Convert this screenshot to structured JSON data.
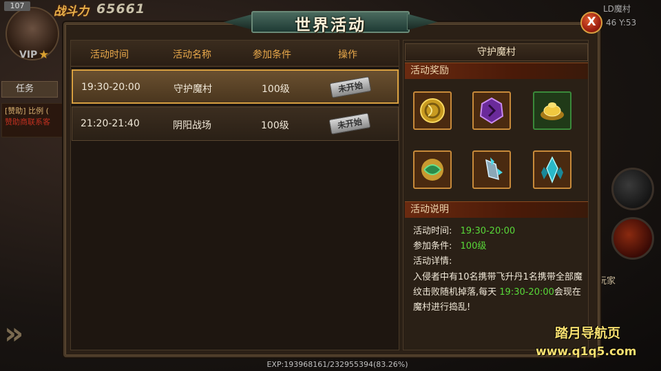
{
  "hud": {
    "level_badge": "107",
    "power_label": "战斗力",
    "power_value": "65661",
    "vip_label": "VIP",
    "task_tab": "任务",
    "chat_line1": "[赞助] 比例 (",
    "chat_line2": "赞助商联系客",
    "map_name": "LD魔村",
    "map_coords": "46 Y:53",
    "player_label": "玩家",
    "exp_text": "EXP:193968161/232955394(83.26%)"
  },
  "window": {
    "title": "世界活动",
    "close_label": "X"
  },
  "table": {
    "columns": [
      "活动时间",
      "活动名称",
      "参加条件",
      "操作"
    ],
    "rows": [
      {
        "time": "19:30-20:00",
        "name": "守护魔村",
        "condition": "100级",
        "status": "未开始"
      },
      {
        "time": "21:20-21:40",
        "name": "阴阳战场",
        "condition": "100级",
        "status": "未开始"
      }
    ]
  },
  "detail": {
    "header": "守护魔村",
    "rewards_label": "活动奖励",
    "rewards": [
      {
        "icon": "gold-coin-icon"
      },
      {
        "icon": "purple-gem-icon"
      },
      {
        "icon": "gold-ingot-icon"
      },
      {
        "icon": "green-orb-icon"
      },
      {
        "icon": "blue-relic-icon"
      },
      {
        "icon": "cyan-crystal-icon"
      }
    ],
    "desc_label": "活动说明",
    "time_label": "活动时间:",
    "time_value": "19:30-20:00",
    "cond_label": "参加条件:",
    "cond_value": "100级",
    "detail_label": "活动详情:",
    "desc_text_1": "入侵者中有10名携带飞升丹1名携带全部魔纹击败随机掉落,每天",
    "desc_time": "19:30-20:00",
    "desc_text_2": "会现在魔村进行捣乱!"
  },
  "watermark": {
    "line1": "踏月导航页",
    "line2": "www.q1q5.com"
  }
}
